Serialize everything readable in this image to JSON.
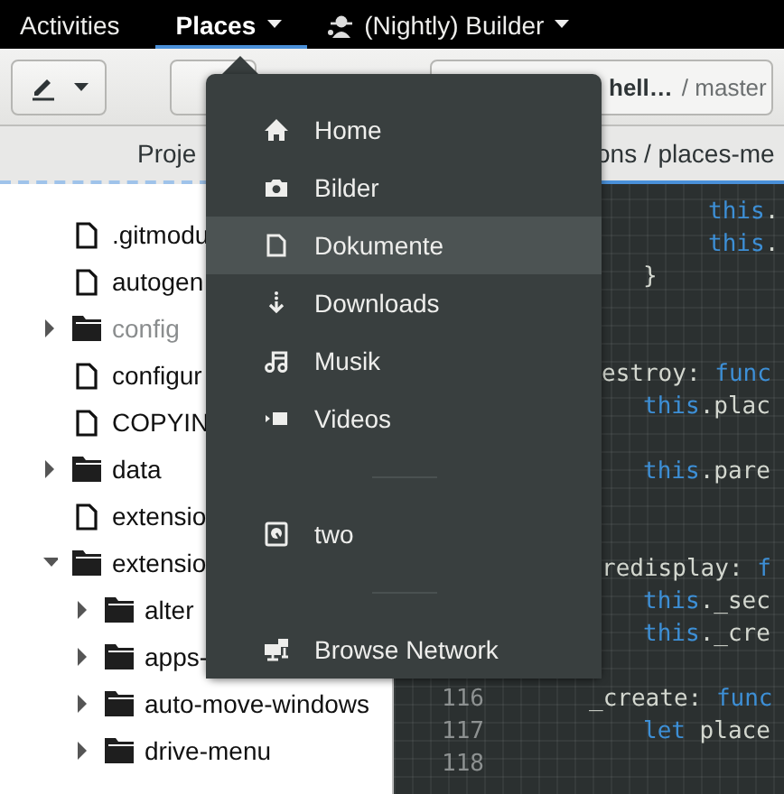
{
  "top_bar": {
    "items": [
      {
        "label": "Activities",
        "kind": "plain",
        "selected": false
      },
      {
        "label": "Places",
        "kind": "menu",
        "selected": true
      },
      {
        "label": "(Nightly) Builder",
        "kind": "app",
        "selected": false
      }
    ]
  },
  "header_bar": {
    "path": {
      "project": "hell…",
      "branch": "/ master"
    }
  },
  "sidebar": {
    "title": "Proje",
    "tree": [
      {
        "label": ".gitmodu",
        "kind": "file",
        "dimmed": false
      },
      {
        "label": "autogen",
        "kind": "file",
        "dimmed": false
      },
      {
        "label": "config",
        "kind": "folder",
        "expanded": false,
        "dimmed": true
      },
      {
        "label": "configur",
        "kind": "file",
        "dimmed": false
      },
      {
        "label": "COPYIN",
        "kind": "file",
        "dimmed": false
      },
      {
        "label": "data",
        "kind": "folder",
        "expanded": false,
        "dimmed": false
      },
      {
        "label": "extensio",
        "kind": "file",
        "dimmed": false
      },
      {
        "label": "extensio",
        "kind": "folder",
        "expanded": true,
        "dimmed": false,
        "children": [
          {
            "label": "alter",
            "kind": "folder",
            "expanded": false,
            "dimmed": false
          },
          {
            "label": "apps-",
            "kind": "folder",
            "expanded": false,
            "dimmed": false
          },
          {
            "label": "auto-move-windows",
            "kind": "folder",
            "expanded": false,
            "dimmed": false
          },
          {
            "label": "drive-menu",
            "kind": "folder",
            "expanded": false,
            "dimmed": false
          }
        ]
      }
    ]
  },
  "editor": {
    "breadcrumb": "ons / places-me",
    "lines": [
      {
        "kind": "inner",
        "tokens": [
          {
            "text": "this",
            "kind": "keyword"
          },
          {
            "text": ".",
            "kind": "plain"
          }
        ]
      },
      {
        "kind": "inner",
        "tokens": [
          {
            "text": "this",
            "kind": "keyword"
          },
          {
            "text": ".",
            "kind": "plain"
          }
        ]
      },
      {
        "kind": "body",
        "tokens": [
          {
            "text": "}",
            "kind": "plain"
          }
        ]
      },
      {
        "kind": "blank"
      },
      {
        "kind": "blank"
      },
      {
        "kind": "cut",
        "tokens": [
          {
            "text": "estroy: ",
            "kind": "plain"
          },
          {
            "text": "func",
            "kind": "keyword"
          }
        ]
      },
      {
        "kind": "body",
        "tokens": [
          {
            "text": "this",
            "kind": "keyword"
          },
          {
            "text": ".plac",
            "kind": "plain"
          }
        ]
      },
      {
        "kind": "blank"
      },
      {
        "kind": "body",
        "tokens": [
          {
            "text": "this",
            "kind": "keyword"
          },
          {
            "text": ".pare",
            "kind": "plain"
          }
        ]
      },
      {
        "kind": "blank"
      },
      {
        "kind": "blank"
      },
      {
        "kind": "cut",
        "tokens": [
          {
            "text": "redisplay: ",
            "kind": "plain"
          },
          {
            "text": "f",
            "kind": "keyword"
          }
        ]
      },
      {
        "kind": "body",
        "tokens": [
          {
            "text": "this",
            "kind": "keyword"
          },
          {
            "text": "._sec",
            "kind": "plain"
          }
        ]
      },
      {
        "kind": "body",
        "tokens": [
          {
            "text": "this",
            "kind": "keyword"
          },
          {
            "text": "._cre",
            "kind": "plain"
          }
        ]
      },
      {
        "kind": "blank"
      },
      {
        "kind": "method",
        "number": "116",
        "tokens": [
          {
            "text": "_create: ",
            "kind": "plain"
          },
          {
            "text": "func",
            "kind": "keyword"
          }
        ]
      },
      {
        "kind": "statement",
        "number": "117",
        "tokens": [
          {
            "text": "let",
            "kind": "keyword"
          },
          {
            "text": " place",
            "kind": "plain"
          }
        ]
      },
      {
        "kind": "statement",
        "number": "118"
      }
    ]
  },
  "places_menu": {
    "sections": [
      {
        "items": [
          {
            "label": "Home",
            "kind": "home",
            "selected": false
          },
          {
            "label": "Bilder",
            "kind": "pictures",
            "selected": false
          },
          {
            "label": "Dokumente",
            "kind": "documents",
            "selected": true
          },
          {
            "label": "Downloads",
            "kind": "downloads",
            "selected": false
          },
          {
            "label": "Musik",
            "kind": "music",
            "selected": false
          },
          {
            "label": "Videos",
            "kind": "videos",
            "selected": false
          }
        ]
      },
      {
        "items": [
          {
            "label": "two",
            "kind": "drive",
            "selected": false
          }
        ]
      },
      {
        "items": [
          {
            "label": "Browse Network",
            "kind": "network",
            "selected": false
          }
        ]
      }
    ]
  }
}
